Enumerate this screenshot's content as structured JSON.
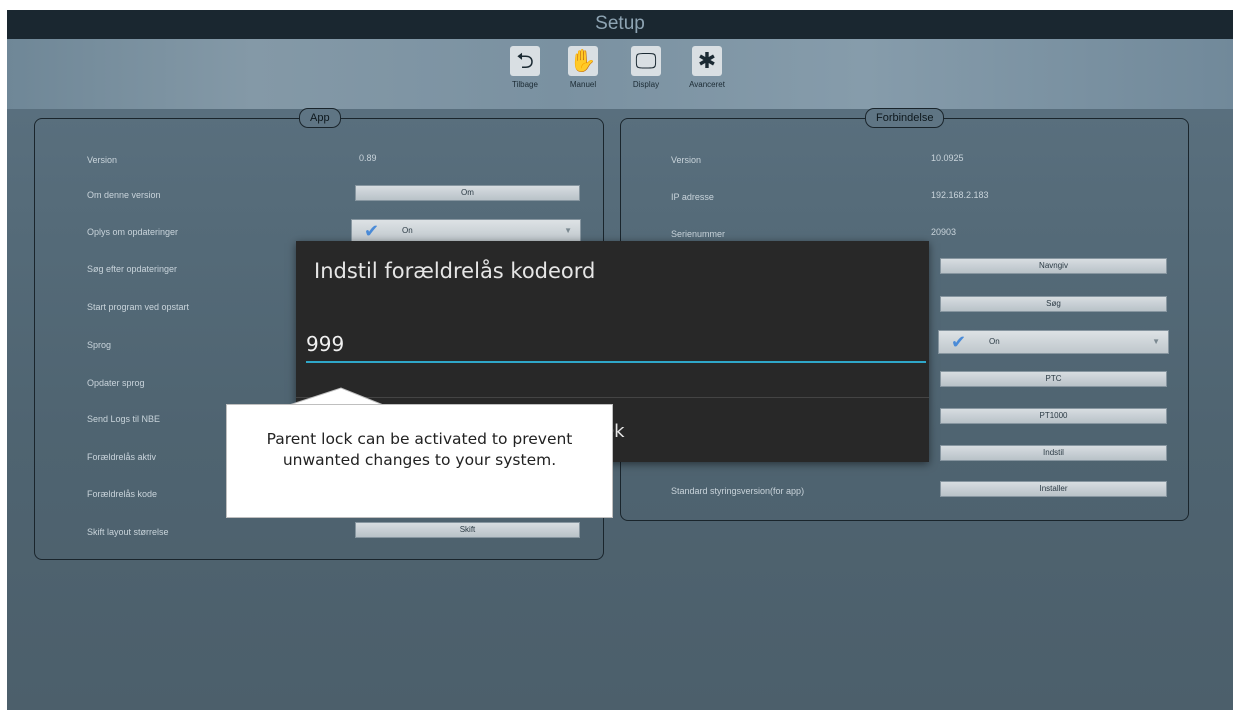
{
  "window": {
    "title": "Setup"
  },
  "nav": [
    {
      "label": "Tilbage",
      "icon": "back-arrow-icon",
      "glyph": "⮌"
    },
    {
      "label": "Manuel",
      "icon": "hand-icon",
      "glyph": "✋"
    },
    {
      "label": "Display",
      "icon": "monitor-icon",
      "glyph": "🖵"
    },
    {
      "label": "Avanceret",
      "icon": "puzzle-icon",
      "glyph": "✱"
    }
  ],
  "app_panel": {
    "title": "App",
    "rows": {
      "version_label": "Version",
      "version_value": "0.89",
      "about_label": "Om denne version",
      "about_button": "Om",
      "updates_info_label": "Oplys om opdateringer",
      "updates_info_value": "On",
      "search_updates_label": "Søg efter opdateringer",
      "start_program_label": "Start program ved opstart",
      "language_label": "Sprog",
      "update_language_label": "Opdater sprog",
      "send_logs_label": "Send Logs til NBE",
      "parent_lock_active_label": "Forældrelås aktiv",
      "parent_lock_code_label": "Forældrelås kode",
      "layout_size_label": "Skift layout størrelse",
      "layout_size_button": "Skift"
    }
  },
  "connection_panel": {
    "title": "Forbindelse",
    "rows": {
      "version_label": "Version",
      "version_value": "10.0925",
      "ip_label": "IP adresse",
      "ip_value": "192.168.2.183",
      "serial_label": "Serienummer",
      "serial_value": "20903",
      "name_button": "Navngiv",
      "search_button": "Søg",
      "toggle_value": "On",
      "ptc_button": "PTC",
      "pt1000_button": "PT1000",
      "set_button": "Indstil",
      "std_control_label": "Standard styringsversion(for app)",
      "install_button": "Installer"
    }
  },
  "dialog": {
    "title": "Indstil forældrelås kodeord",
    "input_value": "999",
    "ok_label": "Ok"
  },
  "tooltip": {
    "text": "Parent lock can be activated to prevent unwanted changes to your system."
  },
  "colors": {
    "accent": "#2fa7c9",
    "check": "#4a8bd8",
    "dialog_bg": "#282828"
  }
}
